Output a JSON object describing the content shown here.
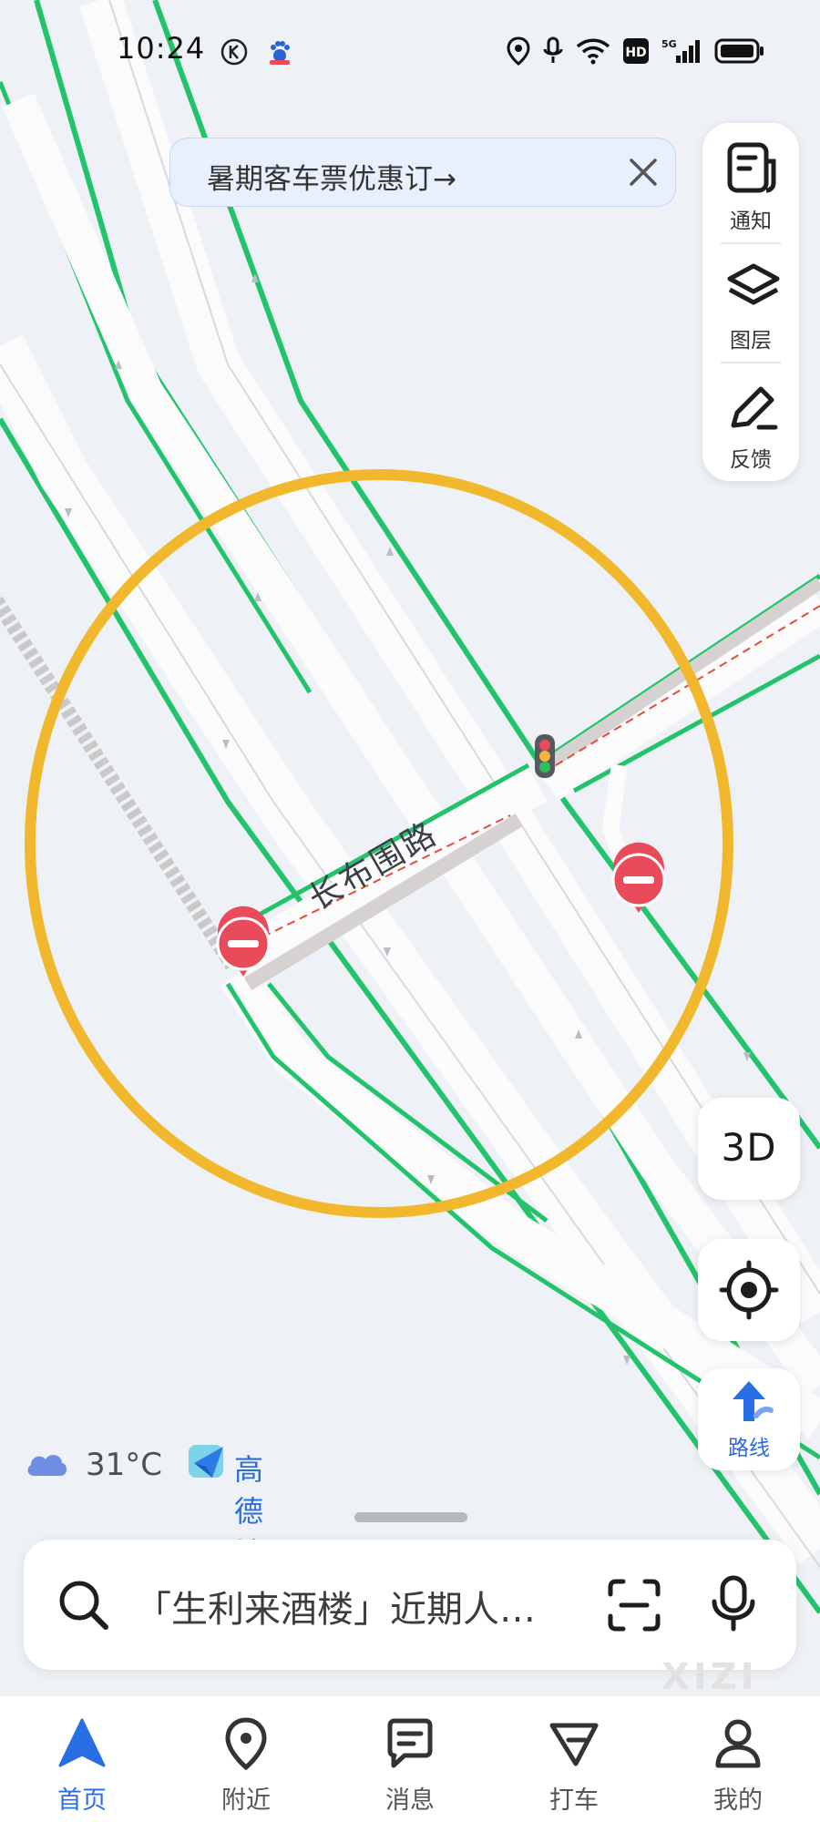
{
  "status_bar": {
    "time": "10:24",
    "left_badges": [
      "k-badge-icon",
      "paw-app-icon"
    ],
    "icons": [
      "location-icon",
      "mic-icon",
      "wifi-icon",
      "hd-icon",
      "5g-signal-icon",
      "battery-icon"
    ],
    "hd_label": "HD",
    "network_label": "5G"
  },
  "banner": {
    "text": "暑期客车票优惠订→",
    "close_icon": "close-icon"
  },
  "side_panel": {
    "items": [
      {
        "label": "通知",
        "icon": "notice-icon"
      },
      {
        "label": "图层",
        "icon": "layers-icon"
      },
      {
        "label": "反馈",
        "icon": "feedback-pen-icon"
      }
    ]
  },
  "controls": {
    "view_3d_label": "3D",
    "locate_icon": "crosshair-icon",
    "route_label": "路线",
    "route_icon": "route-arrow-icon"
  },
  "map": {
    "road_label": "长布围路",
    "markers": [
      "no-entry-marker",
      "no-entry-marker",
      "traffic-light-marker"
    ],
    "annotation": "highlight-circle",
    "colors": {
      "background": "#eef2f6",
      "road": "#fbfbfc",
      "road_edge_green": "#23c36b",
      "rail_gray": "#c8c8c8",
      "circle": "#f1b82e",
      "marker_red": "#e94b5b",
      "dash_red": "#e0503a"
    }
  },
  "weather": {
    "icon": "cloud-icon",
    "temperature": "31°C"
  },
  "brand": {
    "icon": "amap-logo-icon",
    "name": "高德地图"
  },
  "search": {
    "placeholder": "「生利来酒楼」近期人…",
    "search_icon": "search-icon",
    "scan_icon": "scan-icon",
    "voice_icon": "microphone-icon"
  },
  "watermark": "XIZI",
  "tabs": [
    {
      "label": "首页",
      "icon": "home-nav-icon",
      "active": true
    },
    {
      "label": "附近",
      "icon": "nearby-pin-icon",
      "active": false
    },
    {
      "label": "消息",
      "icon": "message-icon",
      "active": false
    },
    {
      "label": "打车",
      "icon": "taxi-icon",
      "active": false
    },
    {
      "label": "我的",
      "icon": "profile-icon",
      "active": false
    }
  ],
  "accent_color": "#2a6ee6"
}
